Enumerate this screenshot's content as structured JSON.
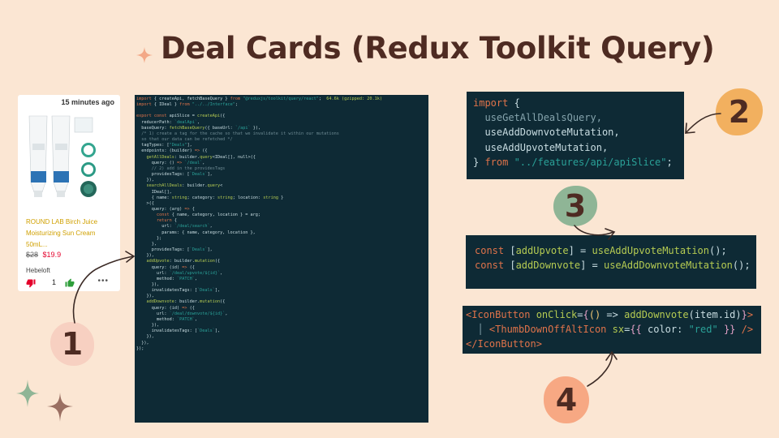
{
  "title": "Deal Cards (Redux Toolkit Query)",
  "card": {
    "time": "15 minutes ago",
    "name": "ROUND LAB Birch Juice Moisturizing Sun Cream 50mL...",
    "old_price": "$28",
    "new_price": "$19.9",
    "seller": "Hebeloft",
    "vote_count": "1",
    "more": "•••"
  },
  "steps": [
    "1",
    "2",
    "3",
    "4"
  ],
  "code_big": [
    {
      "t": [
        [
          "k",
          "import"
        ],
        [
          "w",
          " { createApi, fetchBaseQuery } "
        ],
        [
          "k",
          "from"
        ],
        [
          "s",
          " \"@reduxjs/toolkit/query/react\""
        ],
        [
          "w",
          ";  "
        ],
        [
          "y",
          "64.6k (gzipped: 20.1k)"
        ]
      ]
    },
    {
      "t": [
        [
          "k",
          "import"
        ],
        [
          "w",
          " { IDeal } "
        ],
        [
          "k",
          "from"
        ],
        [
          "s",
          " \"../../Interface\""
        ],
        [
          "w",
          ";"
        ]
      ]
    },
    {
      "t": [
        [
          "w",
          " "
        ]
      ]
    },
    {
      "t": [
        [
          "k",
          "export const "
        ],
        [
          "w",
          "apiSlice = "
        ],
        [
          "y",
          "createApi"
        ],
        [
          "w",
          "({"
        ]
      ]
    },
    {
      "t": [
        [
          "w",
          "  reducerPath: "
        ],
        [
          "s",
          "`dealApi`"
        ],
        [
          "w",
          ","
        ]
      ]
    },
    {
      "t": [
        [
          "w",
          "  baseQuery: "
        ],
        [
          "y",
          "fetchBaseQuery"
        ],
        [
          "w",
          "({ baseUrl: "
        ],
        [
          "s",
          "`/api`"
        ],
        [
          "w",
          " }),"
        ]
      ]
    },
    {
      "t": [
        [
          "m",
          "  /* 1) create a tag for the cache so that we invalidate it within our mutations"
        ]
      ]
    },
    {
      "t": [
        [
          "m",
          "  so that our data can be refetched */"
        ]
      ]
    },
    {
      "t": [
        [
          "w",
          "  tagTypes: ["
        ],
        [
          "s",
          "\"Deals\""
        ],
        [
          "w",
          "],"
        ]
      ]
    },
    {
      "t": [
        [
          "w",
          "  endpoints: (builder) "
        ],
        [
          "k",
          "=>"
        ],
        [
          "w",
          " ({"
        ]
      ]
    },
    {
      "t": [
        [
          "y",
          "    getAllDeals"
        ],
        [
          "w",
          ": builder."
        ],
        [
          "y",
          "query"
        ],
        [
          "w",
          "<IDeal[], null>({"
        ]
      ]
    },
    {
      "t": [
        [
          "w",
          "      query: () "
        ],
        [
          "k",
          "=>"
        ],
        [
          "s",
          " `/deal`"
        ],
        [
          "w",
          ","
        ]
      ]
    },
    {
      "t": [
        [
          "m",
          "      // 2) add in the providesTags"
        ]
      ]
    },
    {
      "t": [
        [
          "w",
          "      providesTags: ["
        ],
        [
          "s",
          "`Deals`"
        ],
        [
          "w",
          "],"
        ]
      ]
    },
    {
      "t": [
        [
          "w",
          "    }),"
        ]
      ]
    },
    {
      "t": [
        [
          "y",
          "    searchAllDeals"
        ],
        [
          "w",
          ": builder."
        ],
        [
          "y",
          "query"
        ],
        [
          "w",
          "<"
        ]
      ]
    },
    {
      "t": [
        [
          "w",
          "      IDeal[],"
        ]
      ]
    },
    {
      "t": [
        [
          "w",
          "      { name: "
        ],
        [
          "y",
          "string"
        ],
        [
          "w",
          "; category: "
        ],
        [
          "y",
          "string"
        ],
        [
          "w",
          "; location: "
        ],
        [
          "y",
          "string"
        ],
        [
          "w",
          " }"
        ]
      ]
    },
    {
      "t": [
        [
          "w",
          "    >({"
        ]
      ]
    },
    {
      "t": [
        [
          "w",
          "      query: (arg) "
        ],
        [
          "k",
          "=>"
        ],
        [
          "w",
          " {"
        ]
      ]
    },
    {
      "t": [
        [
          "k",
          "        const"
        ],
        [
          "w",
          " { name, category, location } = arg;"
        ]
      ]
    },
    {
      "t": [
        [
          "k",
          "        return"
        ],
        [
          "w",
          " {"
        ]
      ]
    },
    {
      "t": [
        [
          "w",
          "          url: "
        ],
        [
          "s",
          "`/deal/search`"
        ],
        [
          "w",
          ","
        ]
      ]
    },
    {
      "t": [
        [
          "w",
          "          params: { name, category, location },"
        ]
      ]
    },
    {
      "t": [
        [
          "w",
          "        };"
        ]
      ]
    },
    {
      "t": [
        [
          "w",
          "      },"
        ]
      ]
    },
    {
      "t": [
        [
          "w",
          "      providesTags: ["
        ],
        [
          "s",
          "`Deals`"
        ],
        [
          "w",
          "],"
        ]
      ]
    },
    {
      "t": [
        [
          "w",
          "    }),"
        ]
      ]
    },
    {
      "t": [
        [
          "y",
          "    addUpvote"
        ],
        [
          "w",
          ": builder."
        ],
        [
          "y",
          "mutation"
        ],
        [
          "w",
          "({"
        ]
      ]
    },
    {
      "t": [
        [
          "w",
          "      query: (id) "
        ],
        [
          "k",
          "=>"
        ],
        [
          "w",
          " ({"
        ]
      ]
    },
    {
      "t": [
        [
          "w",
          "        url: "
        ],
        [
          "s",
          "`/deal/upvote/${id}`"
        ],
        [
          "w",
          ","
        ]
      ]
    },
    {
      "t": [
        [
          "w",
          "        method: "
        ],
        [
          "s",
          "`PATCH`"
        ],
        [
          "w",
          ","
        ]
      ]
    },
    {
      "t": [
        [
          "w",
          "      }),"
        ]
      ]
    },
    {
      "t": [
        [
          "w",
          "      invalidatesTags: ["
        ],
        [
          "s",
          "`Deals`"
        ],
        [
          "w",
          "],"
        ]
      ]
    },
    {
      "t": [
        [
          "w",
          "    }),"
        ]
      ]
    },
    {
      "t": [
        [
          "y",
          "    addDownvote"
        ],
        [
          "w",
          ": builder."
        ],
        [
          "y",
          "mutation"
        ],
        [
          "w",
          "({"
        ]
      ]
    },
    {
      "t": [
        [
          "w",
          "      query: (id) "
        ],
        [
          "k",
          "=>"
        ],
        [
          "w",
          " ({"
        ]
      ]
    },
    {
      "t": [
        [
          "w",
          "        url: "
        ],
        [
          "s",
          "`/deal/downvote/${id}`"
        ],
        [
          "w",
          ","
        ]
      ]
    },
    {
      "t": [
        [
          "w",
          "        method: "
        ],
        [
          "s",
          "`PATCH`"
        ],
        [
          "w",
          ","
        ]
      ]
    },
    {
      "t": [
        [
          "w",
          "      }),"
        ]
      ]
    },
    {
      "t": [
        [
          "w",
          "      invalidatesTags: ["
        ],
        [
          "s",
          "`Deals`"
        ],
        [
          "w",
          "],"
        ]
      ]
    },
    {
      "t": [
        [
          "w",
          "    }),"
        ]
      ]
    },
    {
      "t": [
        [
          "w",
          "  }),"
        ]
      ]
    },
    {
      "t": [
        [
          "w",
          "});"
        ]
      ]
    }
  ],
  "code2": [
    {
      "t": [
        [
          "k",
          "import"
        ],
        [
          "w",
          " {"
        ]
      ]
    },
    {
      "t": [
        [
          "g",
          "  useGetAllDealsQuery,"
        ]
      ]
    },
    {
      "t": [
        [
          "w",
          "  useAddDownvoteMutation,"
        ]
      ]
    },
    {
      "t": [
        [
          "w",
          "  useAddUpvoteMutation,"
        ]
      ]
    },
    {
      "t": [
        [
          "w",
          "} "
        ],
        [
          "k",
          "from"
        ],
        [
          "s",
          " \"../features/api/apiSlice\""
        ],
        [
          "w",
          ";"
        ]
      ]
    }
  ],
  "code3": [
    {
      "t": [
        [
          "k",
          "const"
        ],
        [
          "w",
          " ["
        ],
        [
          "y",
          "addUpvote"
        ],
        [
          "w",
          "] = "
        ],
        [
          "y",
          "useAddUpvoteMutation"
        ],
        [
          "w",
          "();"
        ]
      ]
    },
    {
      "t": [
        [
          "k",
          "const"
        ],
        [
          "w",
          " ["
        ],
        [
          "y",
          "addDownvote"
        ],
        [
          "w",
          "] = "
        ],
        [
          "y",
          "useAddDownvoteMutation"
        ],
        [
          "w",
          "();"
        ]
      ]
    }
  ],
  "code4": [
    {
      "t": [
        [
          "k",
          "<IconButton"
        ],
        [
          "y",
          " onClick"
        ],
        [
          "w",
          "="
        ],
        [
          "p",
          "{"
        ],
        [
          "o",
          "()"
        ],
        [
          "w",
          " => "
        ],
        [
          "y",
          "addDownvote"
        ],
        [
          "w",
          "(item.id)"
        ],
        [
          "p",
          "}"
        ],
        [
          "k",
          ">"
        ]
      ]
    },
    {
      "t": [
        [
          "g",
          "  │ "
        ],
        [
          "k",
          "<ThumbDownOffAltIcon"
        ],
        [
          "y",
          " sx"
        ],
        [
          "w",
          "="
        ],
        [
          "p",
          "{{"
        ],
        [
          "w",
          " color: "
        ],
        [
          "s",
          "\"red\""
        ],
        [
          "w",
          " "
        ],
        [
          "p",
          "}}"
        ],
        [
          "k",
          " />"
        ]
      ]
    },
    {
      "t": [
        [
          "k",
          "</IconButton>"
        ]
      ]
    }
  ],
  "colors": {
    "background": "#fbe6d3",
    "title": "#4e2b22",
    "code_bg": "#0e2a35",
    "blob1": "#f7d0c1",
    "blob2": "#f2b05f",
    "blob3": "#8fb596",
    "blob4": "#f7a883"
  }
}
